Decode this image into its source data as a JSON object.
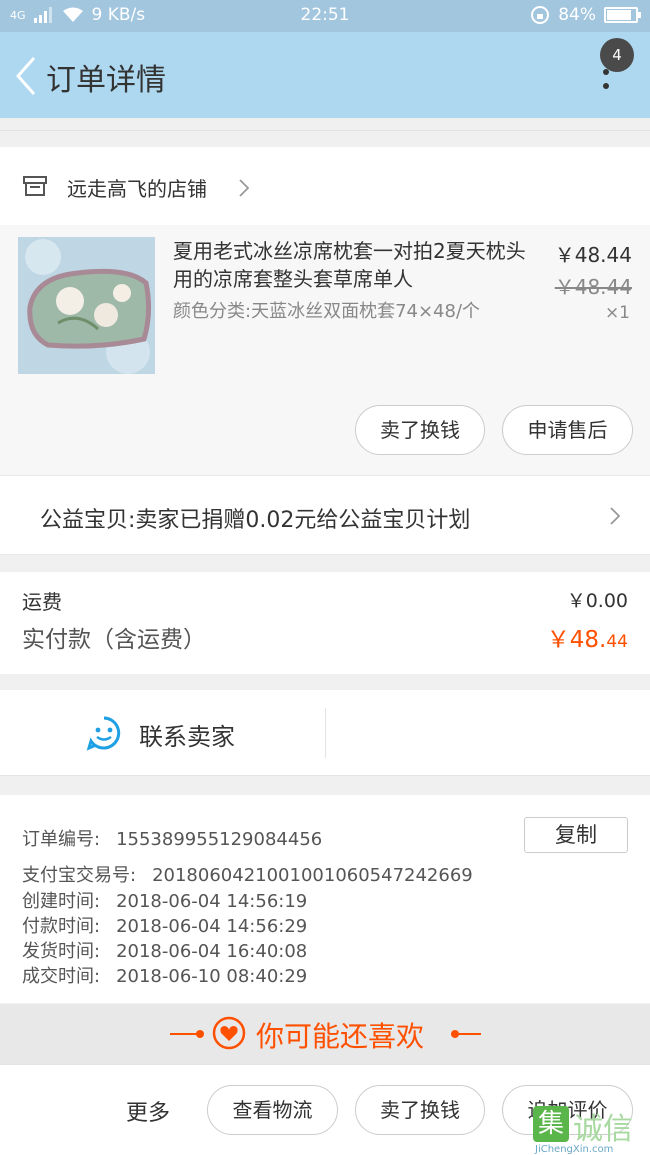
{
  "status_bar": {
    "network": "4G",
    "speed": "9 KB/s",
    "time": "22:51",
    "battery": "84%"
  },
  "app_bar": {
    "title": "订单详情",
    "badge_count": "4"
  },
  "shop": {
    "name": "远走高飞的店铺"
  },
  "item": {
    "title": "夏用老式冰丝凉席枕套一对拍2夏天枕头用的凉席套整头套草席单人",
    "sku": "颜色分类:天蓝冰丝双面枕套74×48/个",
    "price": "￥48.44",
    "original_price": "￥48.44",
    "quantity": "×1",
    "buttons": [
      "卖了换钱",
      "申请售后"
    ]
  },
  "charity": {
    "text": "公益宝贝:卖家已捐赠0.02元给公益宝贝计划"
  },
  "totals": {
    "shipping_label": "运费",
    "shipping_value": "￥0.00",
    "paid_label": "实付款（含运费）",
    "paid_value_main": "￥48.",
    "paid_value_cents": "44"
  },
  "contact": {
    "label": "联系卖家"
  },
  "order_info": {
    "copy_label": "复制",
    "rows": [
      {
        "label": "订单编号:",
        "value": "155389955129084456"
      },
      {
        "label": "支付宝交易号:",
        "value": "2018060421001001060547242669"
      },
      {
        "label": "创建时间:",
        "value": "2018-06-04 14:56:19"
      },
      {
        "label": "付款时间:",
        "value": "2018-06-04 14:56:29"
      },
      {
        "label": "发货时间:",
        "value": "2018-06-04 16:40:08"
      },
      {
        "label": "成交时间:",
        "value": "2018-06-10 08:40:29"
      }
    ]
  },
  "recommend": {
    "title": "你可能还喜欢"
  },
  "footer": {
    "more_label": "更多",
    "buttons": [
      "查看物流",
      "卖了换钱",
      "追加评价"
    ]
  },
  "watermark": {
    "text": "诚信",
    "sub": "JiChengXin.com"
  },
  "colors": {
    "status_bar": "#a3c6df",
    "app_bar": "#add8ef",
    "accent": "#ff5000",
    "contact_icon": "#1ea0e5"
  }
}
